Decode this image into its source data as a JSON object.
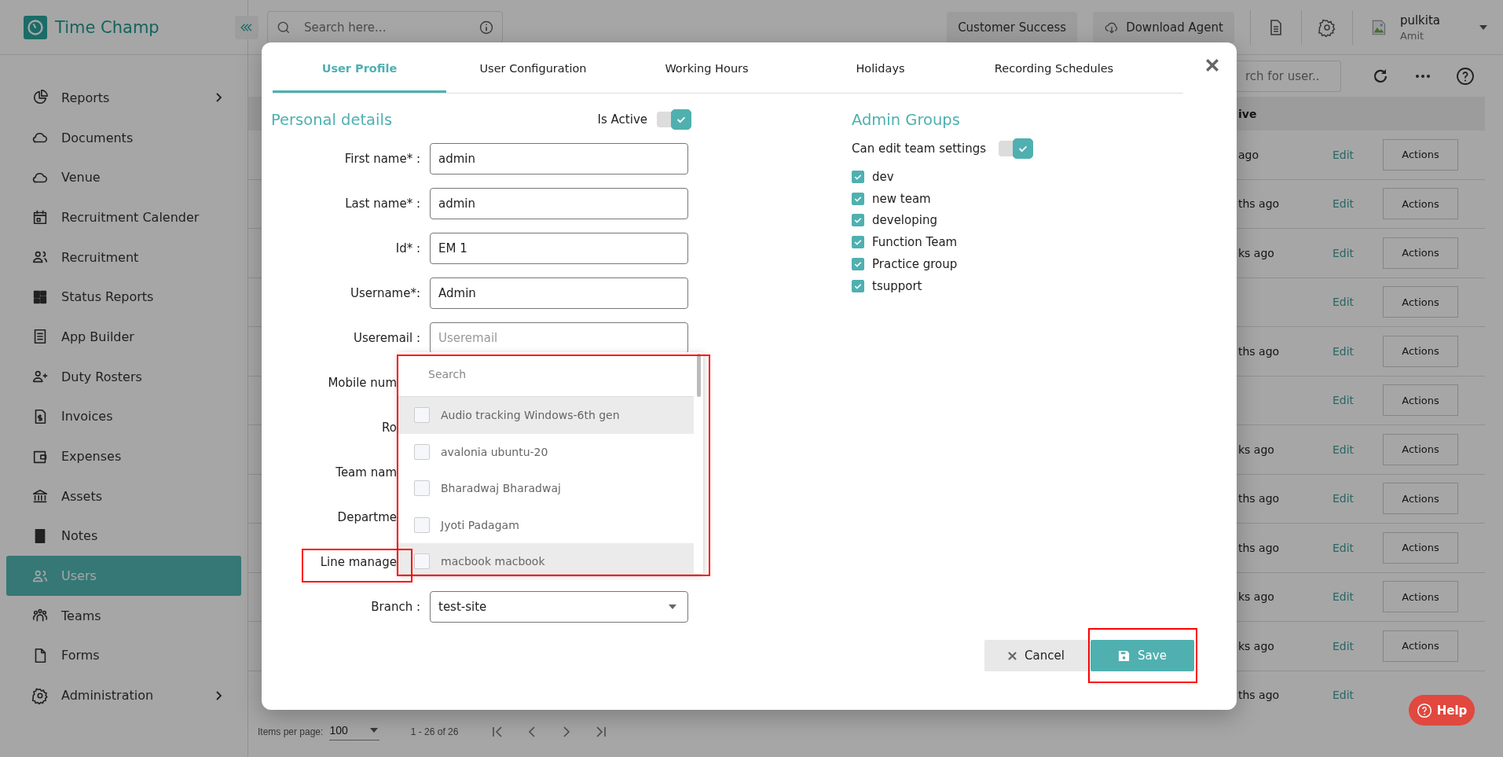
{
  "app": {
    "logo": "Time Champ"
  },
  "sidebar": {
    "items": [
      {
        "label": "Reports",
        "selected": false,
        "has_submenu": true
      },
      {
        "label": "Documents",
        "selected": false,
        "has_submenu": false
      },
      {
        "label": "Venue",
        "selected": false,
        "has_submenu": false
      },
      {
        "label": "Recruitment Calender",
        "selected": false,
        "has_submenu": false
      },
      {
        "label": "Recruitment",
        "selected": false,
        "has_submenu": false
      },
      {
        "label": "Status Reports",
        "selected": false,
        "has_submenu": false
      },
      {
        "label": "App Builder",
        "selected": false,
        "has_submenu": false
      },
      {
        "label": "Duty Rosters",
        "selected": false,
        "has_submenu": false
      },
      {
        "label": "Invoices",
        "selected": false,
        "has_submenu": false
      },
      {
        "label": "Expenses",
        "selected": false,
        "has_submenu": false
      },
      {
        "label": "Assets",
        "selected": false,
        "has_submenu": false
      },
      {
        "label": "Notes",
        "selected": false,
        "has_submenu": false
      },
      {
        "label": "Users",
        "selected": true,
        "has_submenu": false
      },
      {
        "label": "Teams",
        "selected": false,
        "has_submenu": false
      },
      {
        "label": "Forms",
        "selected": false,
        "has_submenu": false
      },
      {
        "label": "Administration",
        "selected": false,
        "has_submenu": true
      }
    ]
  },
  "topbar": {
    "search": {
      "placeholder": "Search here..."
    },
    "buttons": [
      "Customer Success",
      "Download Agent"
    ],
    "user": {
      "name": "pulkita",
      "role": "Amit"
    }
  },
  "toolbar": {
    "search": {
      "placeholder": "rch for user.."
    }
  },
  "table": {
    "columns": [
      "ive"
    ],
    "rows": [
      {
        "column_1": "ago",
        "link": "Edit",
        "button": "Actions"
      },
      {
        "column_1": "ths ago",
        "link": "Edit",
        "button": "Actions"
      },
      {
        "column_1": "ks ago",
        "link": "Edit",
        "button": "Actions"
      },
      {
        "link": "Edit",
        "button": "Actions"
      },
      {
        "column_1": "ths ago",
        "link": "Edit",
        "button": "Actions"
      },
      {
        "link": "Edit",
        "button": "Actions"
      },
      {
        "column_1": "ks ago",
        "link": "Edit",
        "button": "Actions"
      },
      {
        "column_1": "ths ago",
        "link": "Edit",
        "button": "Actions"
      },
      {
        "column_1": "ths ago",
        "link": "Edit",
        "button": "Actions"
      },
      {
        "column_1": "ks ago",
        "link": "Edit",
        "button": "Actions"
      },
      {
        "column_1": "ks ago",
        "link": "Edit",
        "button": "Actions"
      },
      {
        "column_1": "ths ago",
        "link": "Edit"
      }
    ]
  },
  "pagination": {
    "label": "Items per page:",
    "page_size": "100",
    "range": "1 - 26 of 26"
  },
  "help": "Help",
  "modal": {
    "tabs": [
      {
        "label": "User Profile",
        "selected": true
      },
      {
        "label": "User Configuration",
        "selected": false
      },
      {
        "label": "Working Hours",
        "selected": false
      },
      {
        "label": "Holidays",
        "selected": false
      },
      {
        "label": "Recording Schedules",
        "selected": false
      }
    ],
    "personal": {
      "title": "Personal details",
      "active_label": "Is Active",
      "active": true,
      "fields": [
        {
          "kind": "input",
          "label": "First name* :",
          "value": "admin"
        },
        {
          "kind": "input",
          "label": "Last name* :",
          "value": "admin"
        },
        {
          "kind": "input",
          "label": "Id* :",
          "value": "EM 1"
        },
        {
          "kind": "input",
          "label": "Username*:",
          "value": "Admin"
        },
        {
          "kind": "input",
          "label": "Useremail :",
          "placeholder": "Useremail"
        },
        {
          "kind": "covered",
          "label": "Mobile num"
        },
        {
          "kind": "covered",
          "label": "Ro"
        },
        {
          "kind": "covered",
          "label": "Team nam"
        },
        {
          "kind": "covered",
          "label": "Departme"
        },
        {
          "kind": "covered",
          "label": "Line manage"
        },
        {
          "kind": "select",
          "label": "Branch :",
          "value": "test-site"
        }
      ]
    },
    "admin": {
      "title": "Admin Groups",
      "edit_label": "Can edit team settings",
      "can_edit": true,
      "groups": [
        {
          "label": "dev",
          "checked": true
        },
        {
          "label": "new team",
          "checked": true
        },
        {
          "label": "developing",
          "checked": true
        },
        {
          "label": "Function Team",
          "checked": true
        },
        {
          "label": "Practice group",
          "checked": true
        },
        {
          "label": "tsupport",
          "checked": true
        }
      ]
    },
    "dropdown": {
      "search": {
        "placeholder": "Search"
      },
      "options": [
        {
          "label": "Audio tracking Windows-6th gen",
          "checked": false,
          "active": true
        },
        {
          "label": "avalonia ubuntu-20",
          "checked": false,
          "active": false
        },
        {
          "label": "Bharadwaj Bharadwaj",
          "checked": false,
          "active": false
        },
        {
          "label": "Jyoti Padagam",
          "checked": false,
          "active": false
        },
        {
          "label": "macbook macbook",
          "checked": false,
          "active": true
        }
      ]
    },
    "buttons": {
      "cancel": "Cancel",
      "save": "Save"
    }
  }
}
